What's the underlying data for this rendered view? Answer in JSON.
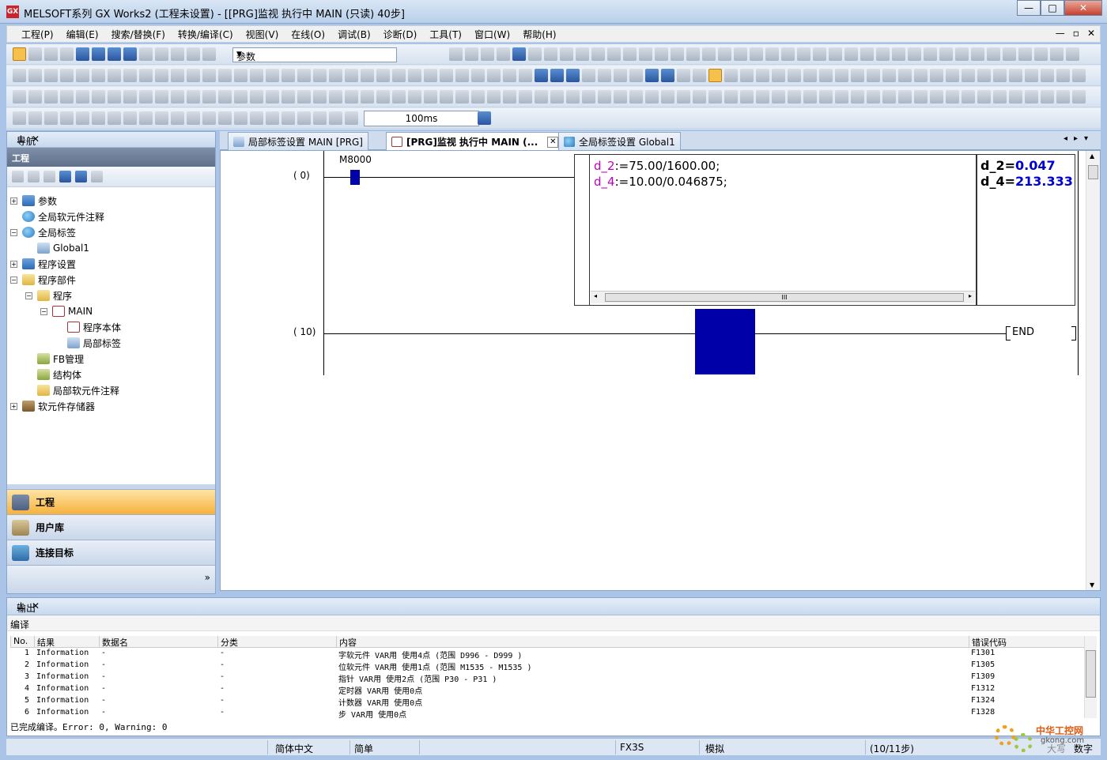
{
  "window": {
    "title": "MELSOFT系列 GX Works2 (工程未设置) - [[PRG]监视 执行中 MAIN (只读) 40步]",
    "icon_text": "GX",
    "minimize": "—",
    "maximize": "□",
    "close": "✕"
  },
  "menu": {
    "items": [
      "工程(P)",
      "编辑(E)",
      "搜索/替换(F)",
      "转换/编译(C)",
      "视图(V)",
      "在线(O)",
      "调试(B)",
      "诊断(D)",
      "工具(T)",
      "窗口(W)",
      "帮助(H)"
    ],
    "mdi_controls": [
      "—",
      "▫",
      "✕"
    ]
  },
  "toolbar": {
    "combo_value": "参数",
    "monitor_interval": "100ms"
  },
  "navigation": {
    "title": "导航",
    "pin": "⊥",
    "close": "✕",
    "section": "工程",
    "tree": [
      {
        "label": "参数",
        "icon": "param-icon",
        "expander": "+"
      },
      {
        "label": "全局软元件注释",
        "icon": "globe-icon",
        "expander": ""
      },
      {
        "label": "全局标签",
        "icon": "globe-icon",
        "expander": "−"
      },
      {
        "label": "Global1",
        "icon": "table-icon",
        "expander": ""
      },
      {
        "label": "程序设置",
        "icon": "param-icon",
        "expander": "+"
      },
      {
        "label": "程序部件",
        "icon": "folder-icon",
        "expander": "−"
      },
      {
        "label": "程序",
        "icon": "folder-icon",
        "expander": "−"
      },
      {
        "label": "MAIN",
        "icon": "program-icon",
        "expander": "−"
      },
      {
        "label": "程序本体",
        "icon": "program-icon",
        "expander": ""
      },
      {
        "label": "局部标签",
        "icon": "table-icon",
        "expander": ""
      },
      {
        "label": "FB管理",
        "icon": "fb-icon",
        "expander": ""
      },
      {
        "label": "结构体",
        "icon": "fb-icon",
        "expander": ""
      },
      {
        "label": "局部软元件注释",
        "icon": "folder-icon",
        "expander": ""
      },
      {
        "label": "软元件存储器",
        "icon": "memory-icon",
        "expander": "+"
      }
    ],
    "buttons": [
      "工程",
      "用户库",
      "连接目标"
    ],
    "more": "»"
  },
  "tabs": [
    {
      "label": "局部标签设置 MAIN [PRG]",
      "active": false
    },
    {
      "label": "[PRG]监视 执行中 MAIN (...",
      "active": true
    },
    {
      "label": "全局标签设置 Global1",
      "active": false
    }
  ],
  "tab_close": "✕",
  "tab_nav": "◂▸▾",
  "ladder": {
    "rung1_step": "(   0)",
    "rung2_step": "(  10)",
    "contact": "M8000",
    "st_lines": [
      {
        "var": "d_2",
        "expr": ":=75.00/1600.00;"
      },
      {
        "var": "d_4",
        "expr": ":=10.00/0.046875;"
      }
    ],
    "monitor": [
      {
        "var": "d_2",
        "eq": "=",
        "value": "0.047"
      },
      {
        "var": "d_4",
        "eq": "=",
        "value": "213.333"
      }
    ],
    "end": "END",
    "hscroll_grip": "III"
  },
  "output": {
    "title": "输出",
    "subtitle": "编译",
    "columns": [
      "No.",
      "结果",
      "数据名",
      "分类",
      "内容",
      "错误代码"
    ],
    "rows": [
      {
        "no": "1",
        "result": "Information",
        "data": "-",
        "cat": "-",
        "content": "字软元件 VAR用 使用4点 (范围 D996 - D999 )",
        "code": "F1301"
      },
      {
        "no": "2",
        "result": "Information",
        "data": "-",
        "cat": "-",
        "content": "位软元件 VAR用 使用1点 (范围 M1535 - M1535 )",
        "code": "F1305"
      },
      {
        "no": "3",
        "result": "Information",
        "data": "-",
        "cat": "-",
        "content": "指针 VAR用 使用2点 (范围 P30 - P31 )",
        "code": "F1309"
      },
      {
        "no": "4",
        "result": "Information",
        "data": "-",
        "cat": "-",
        "content": "定时器 VAR用 使用0点",
        "code": "F1312"
      },
      {
        "no": "5",
        "result": "Information",
        "data": "-",
        "cat": "-",
        "content": "计数器 VAR用 使用0点",
        "code": "F1324"
      },
      {
        "no": "6",
        "result": "Information",
        "data": "-",
        "cat": "-",
        "content": "步 VAR用 使用0点",
        "code": "F1328"
      }
    ],
    "status": "已完成编译。Error: 0, Warning: 0"
  },
  "statusbar": {
    "language": "简体中文",
    "mode": "简单",
    "plc": "FX3S",
    "sim": "模拟",
    "steps": "(10/11步)",
    "caps": "大写",
    "num": "数字"
  },
  "watermark": {
    "name": "中华工控网",
    "url": "gkong.com"
  },
  "colors": {
    "accent": "#f6b23e",
    "monitor_value": "#0000d0",
    "st_variable": "#c000c0",
    "contact_on": "#0000a8"
  }
}
